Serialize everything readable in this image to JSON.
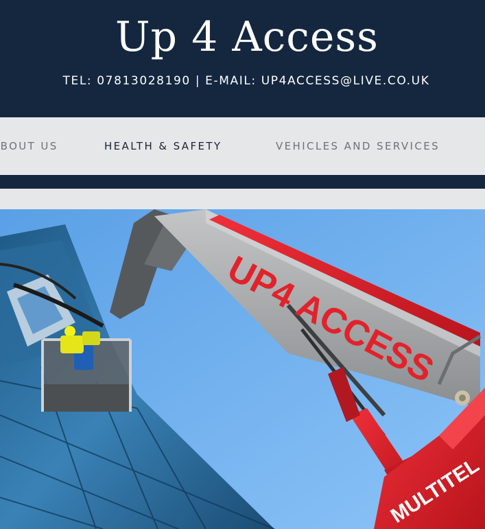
{
  "header": {
    "title": "Up 4 Access",
    "contact": "TEL: 07813028190 | E-MAIL: UP4ACCESS@LIVE.CO.UK"
  },
  "nav": {
    "items": [
      {
        "label": "ABOUT US"
      },
      {
        "label": "HEALTH & SAFETY"
      },
      {
        "label": "VEHICLES AND SERVICES"
      }
    ],
    "active": "HEALTH & SAFETY"
  },
  "hero": {
    "boom_lettering": "UP4 ACCESS",
    "chassis_lettering": "MULTITEL",
    "colors": {
      "sky": "#6aaef0",
      "glass": "#2f6f9e",
      "boom": "#a9acad",
      "red": "#e2222b"
    }
  },
  "colors": {
    "header_bg": "#14273f",
    "nav_bg": "#e6e7e9",
    "nav_text": "#6f7174",
    "nav_active_text": "#1c2430"
  }
}
